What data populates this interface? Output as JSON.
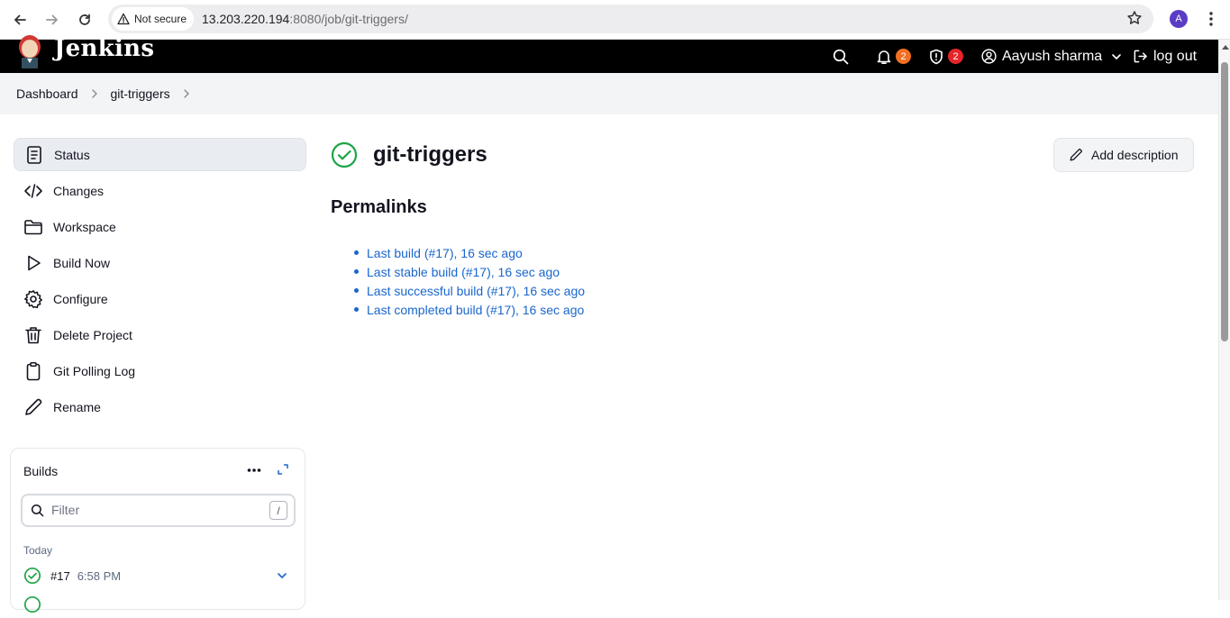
{
  "browser": {
    "security_label": "Not secure",
    "url_host": "13.203.220.194",
    "url_rest": ":8080/job/git-triggers/",
    "profile_initial": "A"
  },
  "header": {
    "brand": "Jenkins",
    "notifications_count": "2",
    "security_count": "2",
    "user_name": "Aayush sharma",
    "logout_label": "log out",
    "notification_badge_color": "#f26f21",
    "security_badge_color": "#e5252a"
  },
  "breadcrumb": {
    "items": [
      "Dashboard",
      "git-triggers"
    ]
  },
  "sidebar": {
    "items": [
      {
        "label": "Status",
        "icon": "status-icon"
      },
      {
        "label": "Changes",
        "icon": "code-icon"
      },
      {
        "label": "Workspace",
        "icon": "folder-icon"
      },
      {
        "label": "Build Now",
        "icon": "play-icon"
      },
      {
        "label": "Configure",
        "icon": "gear-icon"
      },
      {
        "label": "Delete Project",
        "icon": "trash-icon"
      },
      {
        "label": "Git Polling Log",
        "icon": "clipboard-icon"
      },
      {
        "label": "Rename",
        "icon": "pencil-icon"
      }
    ]
  },
  "builds": {
    "title": "Builds",
    "filter_placeholder": "Filter",
    "filter_shortcut": "/",
    "group_label": "Today",
    "items": [
      {
        "number": "#17",
        "time": "6:58 PM",
        "status": "success"
      }
    ]
  },
  "job": {
    "title": "git-triggers",
    "status": "success",
    "add_description_label": "Add description",
    "success_color": "#1ea446"
  },
  "permalinks": {
    "title": "Permalinks",
    "links": [
      "Last build (#17), 16 sec ago",
      "Last stable build (#17), 16 sec ago",
      "Last successful build (#17), 16 sec ago",
      "Last completed build (#17), 16 sec ago"
    ]
  }
}
